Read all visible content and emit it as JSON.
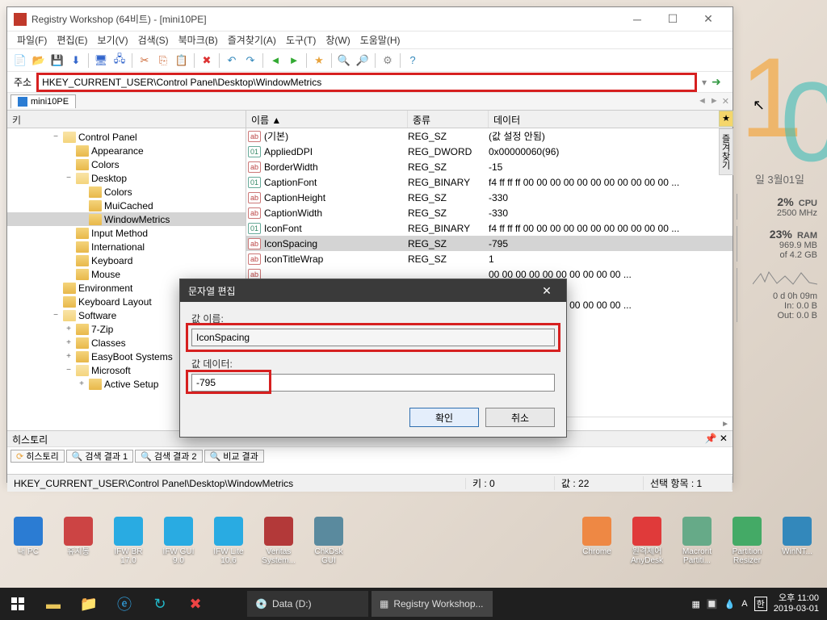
{
  "window": {
    "title": "Registry Workshop (64비트) - [mini10PE]",
    "menus": [
      "파일(F)",
      "편집(E)",
      "보기(V)",
      "검색(S)",
      "북마크(B)",
      "즐겨찾기(A)",
      "도구(T)",
      "창(W)",
      "도움말(H)"
    ],
    "address_label": "주소",
    "address": "HKEY_CURRENT_USER\\Control Panel\\Desktop\\WindowMetrics",
    "tab": "mini10PE"
  },
  "tree_header": "키",
  "tree": [
    {
      "indent": 3,
      "exp": "−",
      "open": true,
      "label": "Control Panel"
    },
    {
      "indent": 4,
      "exp": "",
      "open": false,
      "label": "Appearance"
    },
    {
      "indent": 4,
      "exp": "",
      "open": false,
      "label": "Colors"
    },
    {
      "indent": 4,
      "exp": "−",
      "open": true,
      "label": "Desktop"
    },
    {
      "indent": 5,
      "exp": "",
      "open": false,
      "label": "Colors"
    },
    {
      "indent": 5,
      "exp": "",
      "open": false,
      "label": "MuiCached"
    },
    {
      "indent": 5,
      "exp": "",
      "open": false,
      "label": "WindowMetrics",
      "selected": true
    },
    {
      "indent": 4,
      "exp": "",
      "open": false,
      "label": "Input Method"
    },
    {
      "indent": 4,
      "exp": "",
      "open": false,
      "label": "International"
    },
    {
      "indent": 4,
      "exp": "",
      "open": false,
      "label": "Keyboard"
    },
    {
      "indent": 4,
      "exp": "",
      "open": false,
      "label": "Mouse"
    },
    {
      "indent": 3,
      "exp": "",
      "open": false,
      "label": "Environment"
    },
    {
      "indent": 3,
      "exp": "",
      "open": false,
      "label": "Keyboard Layout"
    },
    {
      "indent": 3,
      "exp": "−",
      "open": true,
      "label": "Software"
    },
    {
      "indent": 4,
      "exp": "+",
      "open": false,
      "label": "7-Zip"
    },
    {
      "indent": 4,
      "exp": "+",
      "open": false,
      "label": "Classes"
    },
    {
      "indent": 4,
      "exp": "+",
      "open": false,
      "label": "EasyBoot Systems"
    },
    {
      "indent": 4,
      "exp": "−",
      "open": true,
      "label": "Microsoft"
    },
    {
      "indent": 5,
      "exp": "+",
      "open": false,
      "label": "Active Setup"
    }
  ],
  "list_headers": {
    "name": "이름 ▲",
    "type": "종류",
    "data": "데이터"
  },
  "list": [
    {
      "icon": "sz",
      "name": "(기본)",
      "type": "REG_SZ",
      "data": "(값 설정 안됨)"
    },
    {
      "icon": "bin",
      "name": "AppliedDPI",
      "type": "REG_DWORD",
      "data": "0x00000060(96)"
    },
    {
      "icon": "sz",
      "name": "BorderWidth",
      "type": "REG_SZ",
      "data": "-15"
    },
    {
      "icon": "bin",
      "name": "CaptionFont",
      "type": "REG_BINARY",
      "data": "f4 ff ff ff 00 00 00 00 00 00 00 00 00 00 00 ..."
    },
    {
      "icon": "sz",
      "name": "CaptionHeight",
      "type": "REG_SZ",
      "data": "-330"
    },
    {
      "icon": "sz",
      "name": "CaptionWidth",
      "type": "REG_SZ",
      "data": "-330"
    },
    {
      "icon": "bin",
      "name": "IconFont",
      "type": "REG_BINARY",
      "data": "f4 ff ff ff 00 00 00 00 00 00 00 00 00 00 00 ..."
    },
    {
      "icon": "sz",
      "name": "IconSpacing",
      "type": "REG_SZ",
      "data": "-795",
      "selected": true
    },
    {
      "icon": "sz",
      "name": "IconTitleWrap",
      "type": "REG_SZ",
      "data": "1"
    },
    {
      "icon": "sz",
      "name": "",
      "type": "",
      "data": "00 00 00 00 00 00 00 00 00 00 ..."
    },
    {
      "icon": "sz",
      "name": "",
      "type": "",
      "data": ""
    },
    {
      "icon": "sz",
      "name": "",
      "type": "",
      "data": "00 00 00 00 00 00 00 00 00 00 ..."
    }
  ],
  "dialog": {
    "title": "문자열 편집",
    "name_label": "값 이름:",
    "name_value": "IconSpacing",
    "data_label": "값 데이터:",
    "data_value": "-795",
    "ok": "확인",
    "cancel": "취소"
  },
  "history": {
    "header": "히스토리",
    "tabs": [
      "히스토리",
      "검색 결과 1",
      "검색 결과 2",
      "비교 결과"
    ]
  },
  "status": {
    "path": "HKEY_CURRENT_USER\\Control Panel\\Desktop\\WindowMetrics",
    "keys": "키 : 0",
    "values": "값 : 22",
    "selected": "선택 항목 : 1"
  },
  "desktop": {
    "date": "일 3월01일",
    "cpu_pct": "2%",
    "cpu_label": "CPU",
    "cpu_freq": "2500 MHz",
    "ram_pct": "23%",
    "ram_label": "RAM",
    "ram_used": "969.9 MB",
    "ram_total": "of 4.2 GB",
    "net_time": "0 d 0h 09m",
    "net_in": "In: 0.0 B",
    "net_out": "Out: 0.0 B"
  },
  "desktop_icons_left": [
    {
      "label": "내 PC",
      "color": "#2b7cd3"
    },
    {
      "label": "휴지통",
      "color": "#c44"
    },
    {
      "label": "IFW BR 17.0",
      "color": "#29abe2"
    },
    {
      "label": "IFW GUI 9.0",
      "color": "#29abe2"
    },
    {
      "label": "IFW Lite 10.6",
      "color": "#29abe2"
    },
    {
      "label": "Veritas System...",
      "color": "#b33939"
    },
    {
      "label": "ChkDsk GUI",
      "color": "#5a8a9e"
    }
  ],
  "desktop_icons_right": [
    {
      "label": "Chrome",
      "color": "#e84"
    },
    {
      "label": "원격제어 AnyDesk",
      "color": "#e03a3a"
    },
    {
      "label": "Macrorit Partiti...",
      "color": "#6a8"
    },
    {
      "label": "Partition Resizer",
      "color": "#4a6"
    },
    {
      "label": "WinNT...",
      "color": "#38b"
    }
  ],
  "taskbar": {
    "tasks": [
      {
        "label": "Data (D:)",
        "icon": "💿"
      },
      {
        "label": "Registry Workshop...",
        "icon": "▦",
        "active": true
      }
    ],
    "time": "오후 11:00",
    "date": "2019-03-01"
  },
  "side_tab_label": "즐겨찾기"
}
